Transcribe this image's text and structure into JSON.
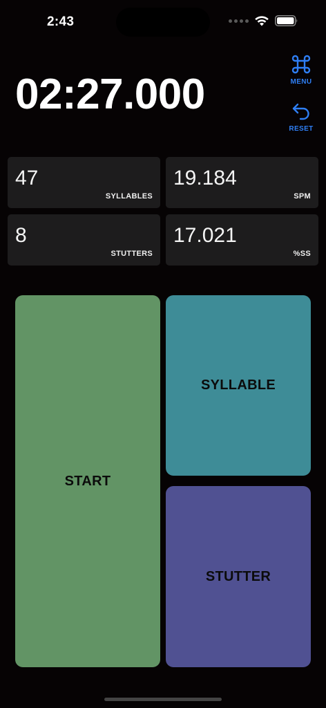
{
  "status_bar": {
    "time": "2:43"
  },
  "timer": {
    "display": "02:27.000"
  },
  "actions": {
    "menu": {
      "label": "MENU",
      "icon": "command-icon"
    },
    "reset": {
      "label": "RESET",
      "icon": "undo-arrow-icon"
    }
  },
  "stats": {
    "syllables": {
      "value": "47",
      "caption": "SYLLABLES"
    },
    "spm": {
      "value": "19.184",
      "caption": "SPM"
    },
    "stutters": {
      "value": "8",
      "caption": "STUTTERS"
    },
    "percent_ss": {
      "value": "17.021",
      "caption": "%SS"
    }
  },
  "buttons": {
    "start": "START",
    "syllable": "SYLLABLE",
    "stutter": "STUTTER"
  },
  "colors": {
    "background": "#060304",
    "accent": "#2f7ff5",
    "card": "#1d1c1d",
    "start": "#629465",
    "syllable": "#3e8c97",
    "stutter": "#505192"
  }
}
